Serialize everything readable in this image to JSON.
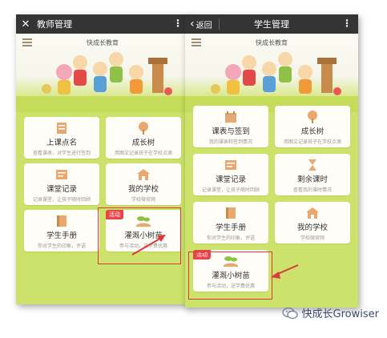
{
  "left_phone": {
    "title": "教师管理",
    "close_icon": "close-icon",
    "more_icon": "more-vertical-icon",
    "school_name": "快成长教育",
    "cards": [
      {
        "title": "上课点名",
        "subtitle": "查看课表，对学生进行签到",
        "icon": "roll-call-icon"
      },
      {
        "title": "成长树",
        "subtitle": "用图文记录孩子在学校点滴",
        "icon": "growth-tree-icon"
      },
      {
        "title": "课堂记录",
        "subtitle": "记录课堂，让孩子随时回顾",
        "icon": "class-record-icon"
      },
      {
        "title": "我的学校",
        "subtitle": "学校微官网",
        "icon": "school-icon"
      },
      {
        "title": "学生手册",
        "subtitle": "你对学生的印象，评语",
        "icon": "handbook-icon"
      },
      {
        "title": "灌溉小树苗",
        "subtitle": "参与活动，送学费优惠",
        "icon": "sapling-icon",
        "badge": "活动"
      }
    ]
  },
  "right_phone": {
    "back_label": "返回",
    "title": "学生管理",
    "more_icon": "more-vertical-icon",
    "school_name": "快成长教育",
    "cards": [
      {
        "title": "课表与签到",
        "subtitle": "我的课表和签到情况",
        "icon": "schedule-icon"
      },
      {
        "title": "成长树",
        "subtitle": "用图文记录孩子在学校点滴",
        "icon": "growth-tree-icon"
      },
      {
        "title": "课堂记录",
        "subtitle": "记录课堂，让孩子随时回顾",
        "icon": "class-record-icon"
      },
      {
        "title": "剩余课时",
        "subtitle": "查看我的课时情况",
        "icon": "hourglass-icon"
      },
      {
        "title": "学生手册",
        "subtitle": "你对学生的印象，评语",
        "icon": "handbook-icon"
      },
      {
        "title": "我的学校",
        "subtitle": "学校微官网",
        "icon": "school-icon"
      },
      {
        "title": "灌溉小树苗",
        "subtitle": "参与活动，送学费优惠",
        "icon": "sapling-icon",
        "badge": "活动"
      }
    ]
  },
  "watermark": {
    "text": "快成长Growiser",
    "icon": "wechat-icon"
  },
  "colors": {
    "titlebar": "#343434",
    "background": "#cde26a",
    "card": "#fffdf7",
    "highlight": "#d93a3a",
    "badge": "#e8454a",
    "icon_orange": "#e0a070"
  }
}
